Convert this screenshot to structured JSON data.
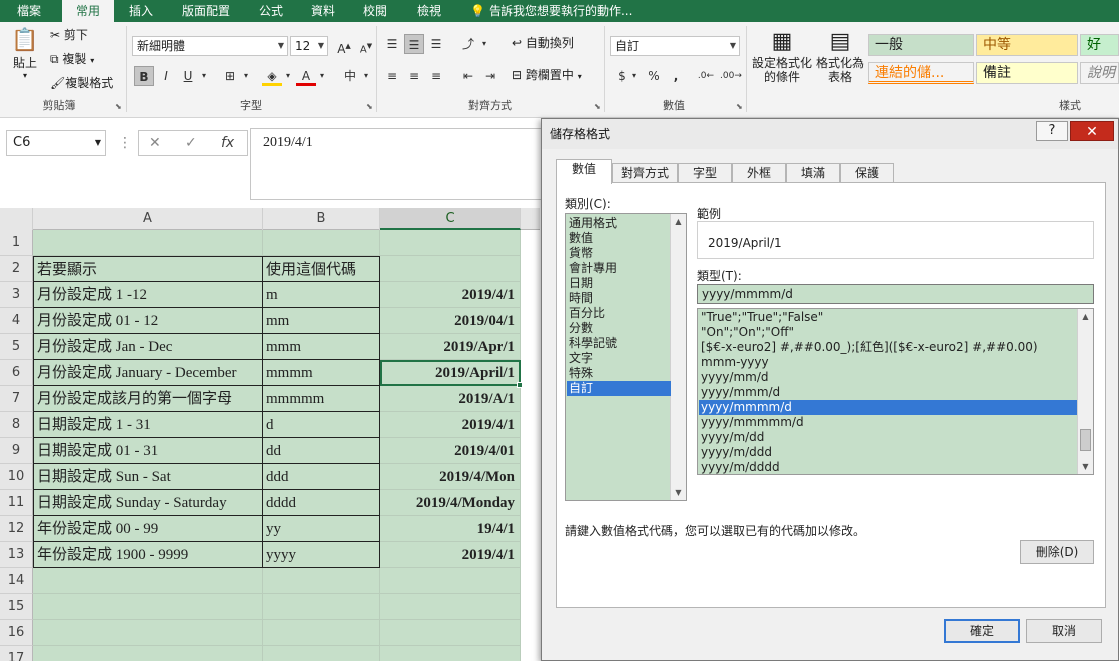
{
  "ribbon_tabs": [
    "檔案",
    "常用",
    "插入",
    "版面配置",
    "公式",
    "資料",
    "校閱",
    "檢視"
  ],
  "active_tab": "常用",
  "tell_me": "告訴我您想要執行的動作...",
  "clipboard": {
    "paste": "貼上",
    "cut": "剪下",
    "copy": "複製",
    "format_painter": "複製格式",
    "label": "剪貼簿"
  },
  "font": {
    "name": "新細明體",
    "size": "12",
    "label": "字型",
    "grow": "A",
    "shrink": "A",
    "bold": "B",
    "italic": "I",
    "underline": "U",
    "font_color_letter": "A",
    "phonetic": "中"
  },
  "alignment": {
    "wrap": "自動換列",
    "merge": "跨欄置中",
    "label": "對齊方式"
  },
  "number": {
    "format": "自訂",
    "currency": "$",
    "percent": "%",
    "comma": ",",
    "label": "數值"
  },
  "styles": {
    "conditional": "設定格式化的條件",
    "as_table": "格式化為表格",
    "cells": [
      "一般",
      "中等",
      "好",
      "連結的儲...",
      "備註",
      "說明"
    ],
    "label": "樣式"
  },
  "name_box": "C6",
  "formula": "2019/4/1",
  "columns": [
    "A",
    "B",
    "C"
  ],
  "rows": [
    {
      "num": "1",
      "a": "",
      "b": "",
      "c": ""
    },
    {
      "num": "2",
      "a": "若要顯示",
      "b": "使用這個代碼",
      "c": ""
    },
    {
      "num": "3",
      "a": "月份設定成 1 -12",
      "b": "m",
      "c": "2019/4/1"
    },
    {
      "num": "4",
      "a": "月份設定成 01 - 12",
      "b": "mm",
      "c": "2019/04/1"
    },
    {
      "num": "5",
      "a": "月份設定成 Jan - Dec",
      "b": "mmm",
      "c": "2019/Apr/1"
    },
    {
      "num": "6",
      "a": "月份設定成 January - December",
      "b": "mmmm",
      "c": "2019/April/1"
    },
    {
      "num": "7",
      "a": "月份設定成該月的第一個字母",
      "b": "mmmmm",
      "c": "2019/A/1"
    },
    {
      "num": "8",
      "a": "日期設定成 1 - 31",
      "b": "d",
      "c": "2019/4/1"
    },
    {
      "num": "9",
      "a": "日期設定成 01 - 31",
      "b": "dd",
      "c": "2019/4/01"
    },
    {
      "num": "10",
      "a": "日期設定成 Sun - Sat",
      "b": "ddd",
      "c": "2019/4/Mon"
    },
    {
      "num": "11",
      "a": "日期設定成 Sunday - Saturday",
      "b": "dddd",
      "c": "2019/4/Monday"
    },
    {
      "num": "12",
      "a": "年份設定成 00 - 99",
      "b": "yy",
      "c": "19/4/1"
    },
    {
      "num": "13",
      "a": "年份設定成 1900 - 9999",
      "b": "yyyy",
      "c": "2019/4/1"
    },
    {
      "num": "14",
      "a": "",
      "b": "",
      "c": ""
    },
    {
      "num": "15",
      "a": "",
      "b": "",
      "c": ""
    },
    {
      "num": "16",
      "a": "",
      "b": "",
      "c": ""
    },
    {
      "num": "17",
      "a": "",
      "b": "",
      "c": ""
    }
  ],
  "dialog": {
    "title": "儲存格格式",
    "help": "?",
    "close": "✕",
    "tabs": [
      "數值",
      "對齊方式",
      "字型",
      "外框",
      "填滿",
      "保護"
    ],
    "category_label": "類別(C):",
    "categories": [
      "通用格式",
      "數值",
      "貨幣",
      "會計專用",
      "日期",
      "時間",
      "百分比",
      "分數",
      "科學記號",
      "文字",
      "特殊",
      "自訂"
    ],
    "selected_category": "自訂",
    "sample_label": "範例",
    "sample_value": "2019/April/1",
    "type_label": "類型(T):",
    "type_value": "yyyy/mmmm/d",
    "formats": [
      "\"True\";\"True\";\"False\"",
      "\"On\";\"On\";\"Off\"",
      "[$€-x-euro2] #,##0.00_);[紅色]([$€-x-euro2] #,##0.00)",
      "mmm-yyyy",
      "yyyy/mm/d",
      "yyyy/mmm/d",
      "yyyy/mmmm/d",
      "yyyy/mmmmm/d",
      "yyyy/m/dd",
      "yyyy/m/ddd",
      "yyyy/m/dddd"
    ],
    "selected_format": "yyyy/mmmm/d",
    "delete_label": "刪除(D)",
    "hint": "請鍵入數值格式代碼，您可以選取已有的代碼加以修改。",
    "ok": "確定",
    "cancel": "取消"
  },
  "colors": {
    "excel_green": "#217346",
    "cell_fill": "#c6dfc9",
    "selection_blue": "#3478d4"
  }
}
